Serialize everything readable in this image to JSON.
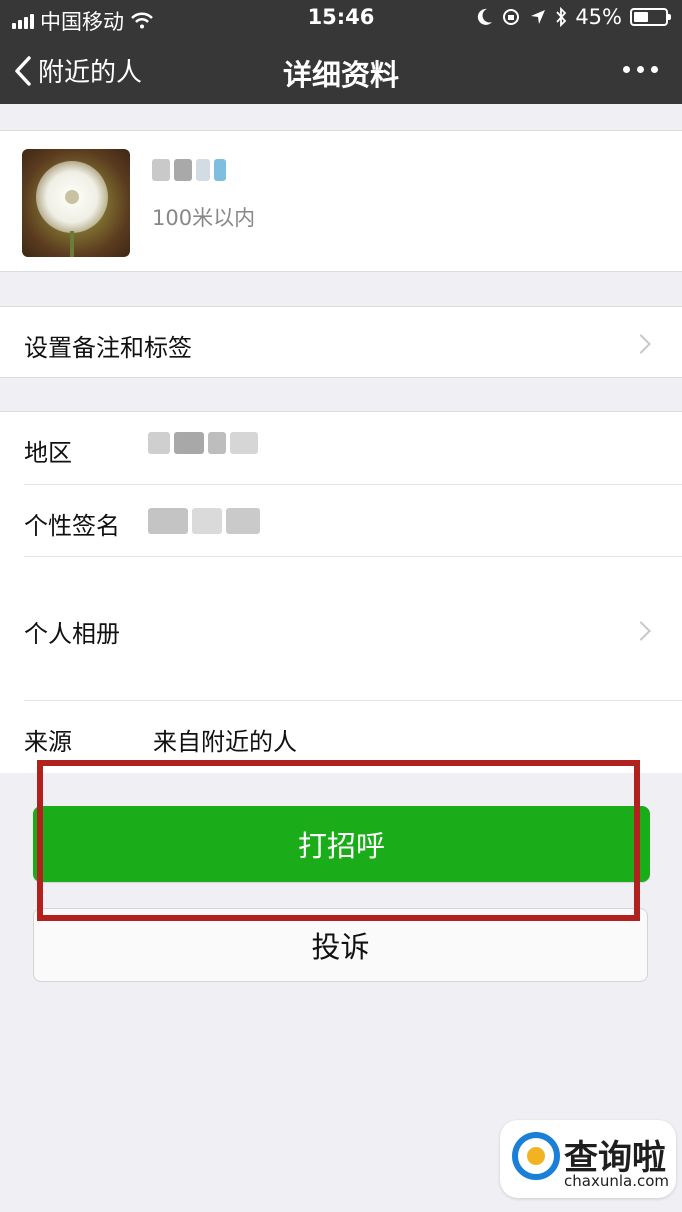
{
  "status_bar": {
    "carrier": "中国移动",
    "time": "15:46",
    "battery": "45%",
    "battery_level": 0.45
  },
  "nav": {
    "back_label": "附近的人",
    "title": "详细资料"
  },
  "profile": {
    "distance": "100米以内"
  },
  "rows": {
    "remark_label": "设置备注和标签",
    "region_label": "地区",
    "signature_label": "个性签名",
    "album_label": "个人相册",
    "source_label": "来源",
    "source_value": "来自附近的人"
  },
  "actions": {
    "greet_label": "打招呼",
    "report_label": "投诉"
  },
  "watermark": {
    "text": "查询啦",
    "domain": "chaxunla.com"
  },
  "colors": {
    "nav_background": "#373737",
    "page_background": "#efeff4",
    "primary_green": "#1aad19",
    "highlight_red": "#b1221f",
    "watermark_blue": "#1a7fd6",
    "watermark_yellow": "#f3b321"
  }
}
